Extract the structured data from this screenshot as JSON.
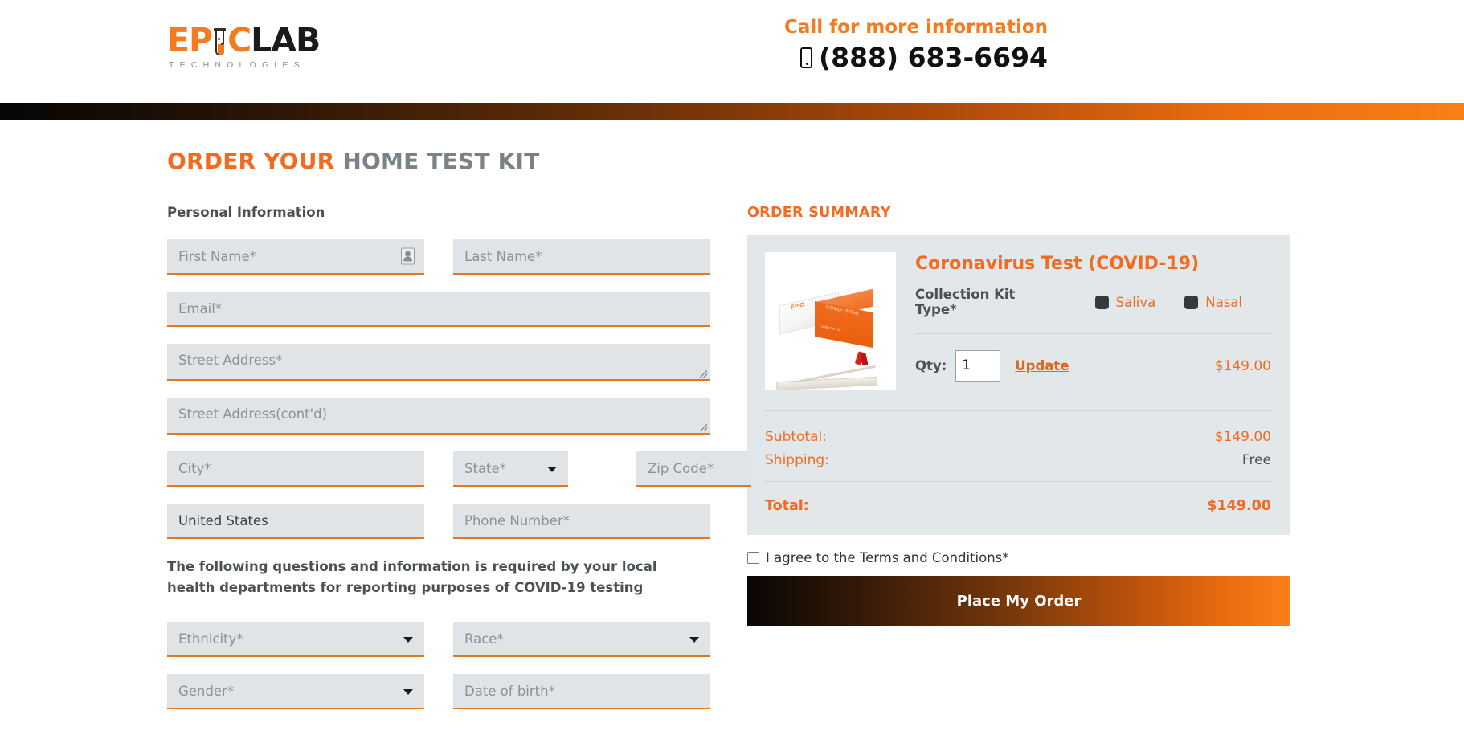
{
  "header": {
    "logo": {
      "part1": "EP",
      "part2": "C",
      "part3": "LAB",
      "tagline": "TECHNOLOGIES"
    },
    "call_label": "Call for more information",
    "phone_number": "(888) 683-6694",
    "phone_icon": "mobile-phone-icon"
  },
  "page_title": {
    "highlight": "ORDER YOUR",
    "rest": " HOME TEST KIT"
  },
  "form": {
    "section_label": "Personal Information",
    "first_name": {
      "placeholder": "First Name*",
      "value": ""
    },
    "last_name": {
      "placeholder": "Last Name*",
      "value": ""
    },
    "email": {
      "placeholder": "Email*",
      "value": ""
    },
    "street_address": {
      "placeholder": "Street Address*",
      "value": ""
    },
    "street_address_2": {
      "placeholder": "Street Address(cont'd)",
      "value": ""
    },
    "city": {
      "placeholder": "City*",
      "value": ""
    },
    "state": {
      "placeholder": "State*",
      "value": ""
    },
    "zip": {
      "placeholder": "Zip Code*",
      "value": ""
    },
    "country": {
      "value": "United States"
    },
    "phone": {
      "placeholder": "Phone Number*",
      "value": ""
    },
    "notice": "The following questions and information is required by your local health departments for reporting purposes of COVID-19 testing",
    "ethnicity": {
      "placeholder": "Ethnicity*",
      "value": ""
    },
    "race": {
      "placeholder": "Race*",
      "value": ""
    },
    "gender": {
      "placeholder": "Gender*",
      "value": ""
    },
    "dob": {
      "placeholder": "Date of birth*",
      "value": ""
    }
  },
  "summary": {
    "title": "ORDER SUMMARY",
    "product_name": "Coronavirus Test (COVID-19)",
    "kit_type_label": "Collection Kit Type*",
    "kit_options": [
      {
        "label": "Saliva",
        "selected": false
      },
      {
        "label": "Nasal",
        "selected": false
      }
    ],
    "qty_label": "Qty:",
    "qty_value": "1",
    "update_label": "Update",
    "line_price": "$149.00",
    "subtotal_label": "Subtotal:",
    "subtotal_value": "$149.00",
    "shipping_label": "Shipping:",
    "shipping_value": "Free",
    "total_label": "Total:",
    "total_value": "$149.00",
    "terms_text": "I agree to the Terms and Conditions*",
    "place_order_label": "Place My Order"
  },
  "colors": {
    "brand_orange": "#f26b21",
    "field_bg": "#e0e4e6",
    "field_underline": "#e07820",
    "card_bg": "#e2e7e9",
    "title_gray": "#7a8287"
  }
}
